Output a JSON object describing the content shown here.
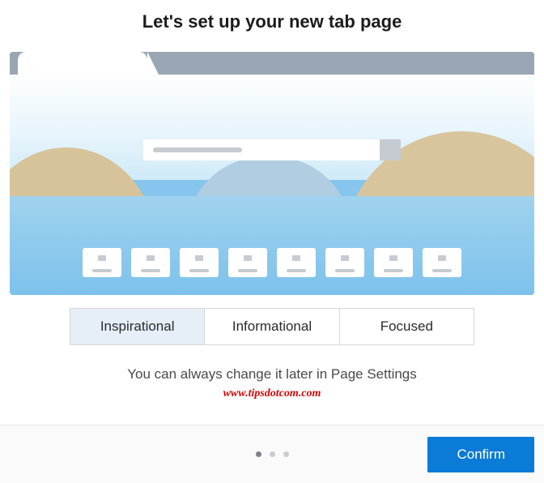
{
  "title": "Let's set up your new tab page",
  "options": {
    "inspirational": "Inspirational",
    "informational": "Informational",
    "focused": "Focused",
    "selected": "inspirational"
  },
  "hint": "You can always change it later in Page Settings",
  "watermark": "www.tipsdotcom.com",
  "footer": {
    "confirm_label": "Confirm",
    "step_active": 1,
    "step_count": 3
  }
}
